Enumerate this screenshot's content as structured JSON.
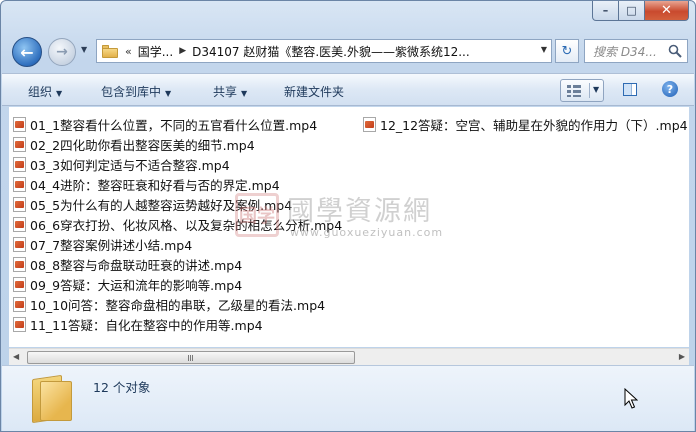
{
  "window": {
    "caption": {
      "minimize": "–",
      "maximize": "□",
      "close": "✕"
    }
  },
  "nav": {
    "back_icon": "←",
    "forward_icon": "→",
    "history_icon": "▼"
  },
  "address": {
    "chevron": "«",
    "segments": [
      "国学...",
      "D34107 赵财猫《整容.医美.外貌——紫微系统12..."
    ],
    "separator": "▶",
    "dropdown": "▼"
  },
  "refresh_icon": "↻",
  "search": {
    "placeholder": "搜索 D34..."
  },
  "toolbar": {
    "organize": "组织",
    "include_in_library": "包含到库中",
    "share": "共享",
    "new_folder": "新建文件夹",
    "dropdown_arrow": "▼",
    "help": "?"
  },
  "files_col1": [
    "01_1整容看什么位置，不同的五官看什么位置.mp4",
    "02_2四化助你看出整容医美的细节.mp4",
    "03_3如何判定适与不适合整容.mp4",
    "04_4进阶：整容旺衰和好看与否的界定.mp4",
    "05_5为什么有的人越整容运势越好及案例.mp4",
    "06_6穿衣打扮、化妆风格、以及复杂的相怎么分析.mp4",
    "07_7整容案例讲述小结.mp4",
    "08_8整容与命盘联动旺衰的讲述.mp4",
    "09_9答疑：大运和流年的影响等.mp4",
    "10_10问答：整容命盘相的串联，乙级星的看法.mp4",
    "11_11答疑：自化在整容中的作用等.mp4"
  ],
  "files_col2": [
    "12_12答疑：空宫、辅助星在外貌的作用力（下）.mp4"
  ],
  "watermark": {
    "seal": "国学",
    "title": "國學資源網",
    "url": "www.guoxueziyuan.com"
  },
  "scrollbar": {
    "left_arrow": "◀",
    "right_arrow": "▶"
  },
  "details": {
    "count_text": "12 个对象"
  },
  "colors": {
    "accent": "#2f6fbe",
    "close": "#c94a2e",
    "folder": "#e2b14a"
  }
}
